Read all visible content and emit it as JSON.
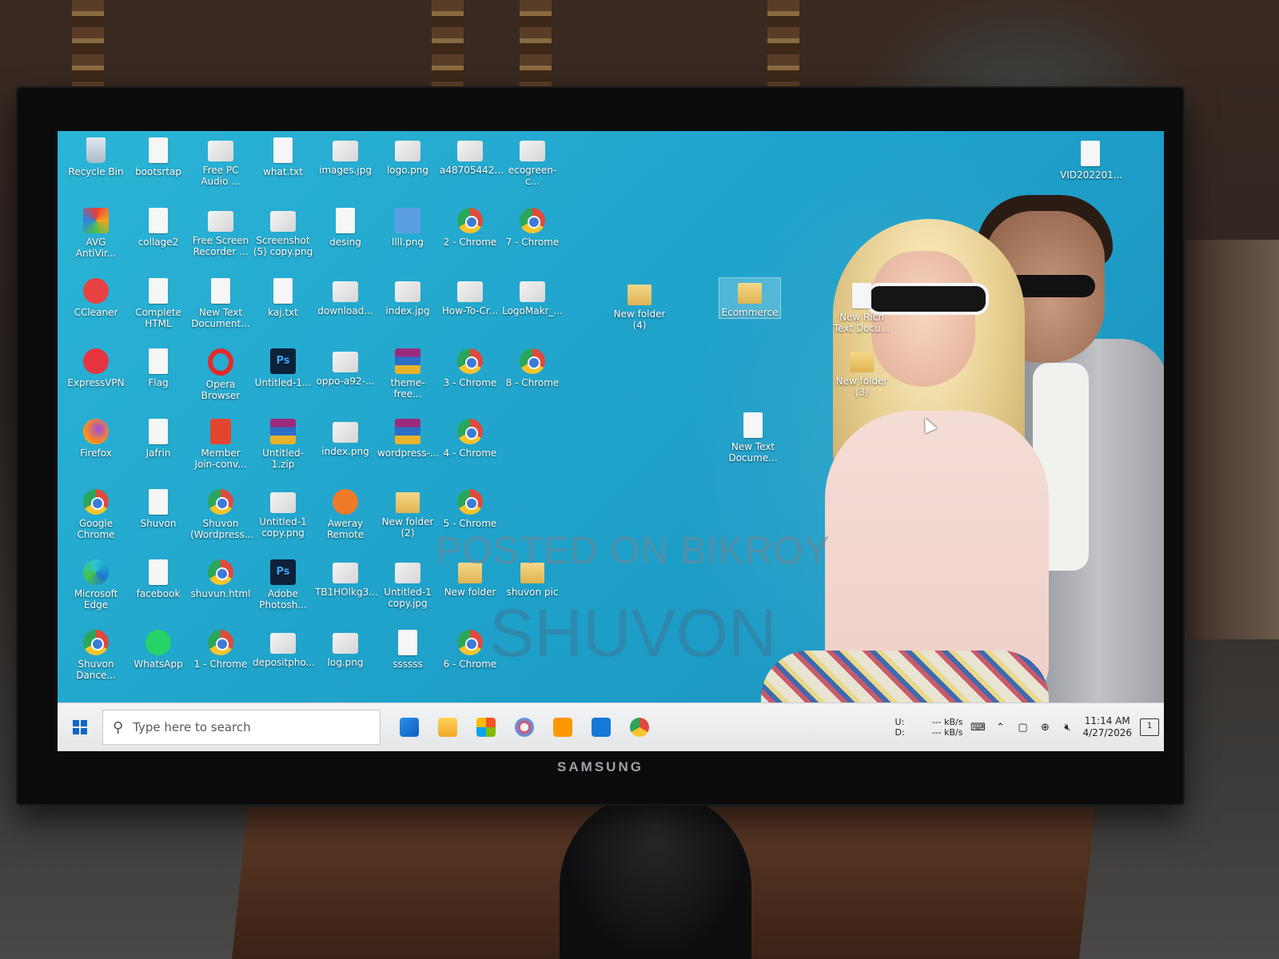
{
  "monitor": {
    "brand": "SAMSUNG"
  },
  "watermark": {
    "line1": "POSTED ON BIKROY",
    "line2": "SHUVON"
  },
  "desktop": {
    "icons": [
      {
        "label": "Recycle Bin",
        "icon": "recycle-bin-icon"
      },
      {
        "label": "bootsrtap",
        "icon": "file-icon"
      },
      {
        "label": "Free PC Audio ...",
        "icon": "app-icon"
      },
      {
        "label": "what.txt",
        "icon": "text-file-icon"
      },
      {
        "label": "images.jpg",
        "icon": "image-file-icon"
      },
      {
        "label": "logo.png",
        "icon": "image-file-icon"
      },
      {
        "label": "a48705442...",
        "icon": "image-file-icon"
      },
      {
        "label": "ecogreen-c...",
        "icon": "image-file-icon"
      },
      {
        "label": "AVG AntiVir...",
        "icon": "avg-icon"
      },
      {
        "label": "collage2",
        "icon": "file-icon"
      },
      {
        "label": "Free Screen Recorder ...",
        "icon": "app-icon"
      },
      {
        "label": "Screenshot (5) copy.png",
        "icon": "image-file-icon"
      },
      {
        "label": "desing",
        "icon": "file-icon"
      },
      {
        "label": "llll.png",
        "icon": "shop-image-icon"
      },
      {
        "label": "2 - Chrome",
        "icon": "chrome-icon"
      },
      {
        "label": "7 - Chrome",
        "icon": "chrome-icon"
      },
      {
        "label": "CCleaner",
        "icon": "ccleaner-icon"
      },
      {
        "label": "Complete HTML",
        "icon": "file-icon"
      },
      {
        "label": "New Text Document...",
        "icon": "text-file-icon"
      },
      {
        "label": "kaj.txt",
        "icon": "text-file-icon"
      },
      {
        "label": "download...",
        "icon": "image-file-icon"
      },
      {
        "label": "index.jpg",
        "icon": "image-file-icon"
      },
      {
        "label": "How-To-Cr...",
        "icon": "image-file-icon"
      },
      {
        "label": "LogoMakr_...",
        "icon": "image-file-icon"
      },
      {
        "label": "ExpressVPN",
        "icon": "expressvpn-icon"
      },
      {
        "label": "Flag",
        "icon": "file-icon"
      },
      {
        "label": "Opera Browser",
        "icon": "opera-icon"
      },
      {
        "label": "Untitled-1...",
        "icon": "photoshop-file-icon"
      },
      {
        "label": "oppo-a92-...",
        "icon": "image-file-icon"
      },
      {
        "label": "theme-free...",
        "icon": "archive-icon"
      },
      {
        "label": "3 - Chrome",
        "icon": "chrome-icon"
      },
      {
        "label": "8 - Chrome",
        "icon": "chrome-icon"
      },
      {
        "label": "Firefox",
        "icon": "firefox-icon"
      },
      {
        "label": "Jafrin",
        "icon": "file-icon"
      },
      {
        "label": "Member Join-conv...",
        "icon": "pdf-icon"
      },
      {
        "label": "Untitled-1.zip",
        "icon": "archive-icon"
      },
      {
        "label": "index.png",
        "icon": "image-file-icon"
      },
      {
        "label": "wordpress-...",
        "icon": "archive-icon"
      },
      {
        "label": "4 - Chrome",
        "icon": "chrome-icon"
      },
      {
        "label": "Google Chrome",
        "icon": "chrome-icon"
      },
      {
        "label": "Shuvon",
        "icon": "file-icon"
      },
      {
        "label": "Shuvon (Wordpress...",
        "icon": "chrome-icon"
      },
      {
        "label": "Untitled-1 copy.png",
        "icon": "image-file-icon"
      },
      {
        "label": "Aweray Remote",
        "icon": "aweray-icon"
      },
      {
        "label": "New folder (2)",
        "icon": "folder-icon"
      },
      {
        "label": "5 - Chrome",
        "icon": "chrome-icon"
      },
      {
        "label": "Microsoft Edge",
        "icon": "edge-icon"
      },
      {
        "label": "facebook",
        "icon": "file-icon"
      },
      {
        "label": "shuvun.html",
        "icon": "chrome-icon"
      },
      {
        "label": "Adobe Photosh...",
        "icon": "photoshop-icon"
      },
      {
        "label": "TB1HOlkg3...",
        "icon": "image-file-icon"
      },
      {
        "label": "Untitled-1 copy.jpg",
        "icon": "image-file-icon"
      },
      {
        "label": "New folder",
        "icon": "folder-icon"
      },
      {
        "label": "shuvon pic",
        "icon": "folder-icon"
      },
      {
        "label": "Shuvon Dance...",
        "icon": "chrome-icon"
      },
      {
        "label": "WhatsApp",
        "icon": "whatsapp-icon"
      },
      {
        "label": "1 - Chrome",
        "icon": "chrome-icon"
      },
      {
        "label": "depositpho...",
        "icon": "image-file-icon"
      },
      {
        "label": "log.png",
        "icon": "image-file-icon"
      },
      {
        "label": "ssssss",
        "icon": "file-icon"
      },
      {
        "label": "6 - Chrome",
        "icon": "chrome-icon"
      },
      {
        "label": "New folder (4)",
        "icon": "folder-icon"
      },
      {
        "label": "Ecommerce",
        "icon": "folder-icon"
      },
      {
        "label": "New Rich Text Docu...",
        "icon": "text-file-icon"
      },
      {
        "label": "New folder (3)",
        "icon": "folder-icon"
      },
      {
        "label": "New Text Docume...",
        "icon": "text-file-icon"
      },
      {
        "label": "VID202201...",
        "icon": "video-file-icon"
      }
    ]
  },
  "taskbar": {
    "search_placeholder": "Type here to search",
    "pinned": [
      "mail-icon",
      "file-explorer-icon",
      "store-icon",
      "paint-icon",
      "sublime-icon",
      "media-player-icon",
      "chrome-icon"
    ],
    "net_labels": [
      "U:",
      "D:"
    ],
    "net_values": [
      "--- kB/s",
      "--- kB/s"
    ],
    "time": "11:14 AM",
    "date": "4/27/2026",
    "notifications": "1"
  }
}
